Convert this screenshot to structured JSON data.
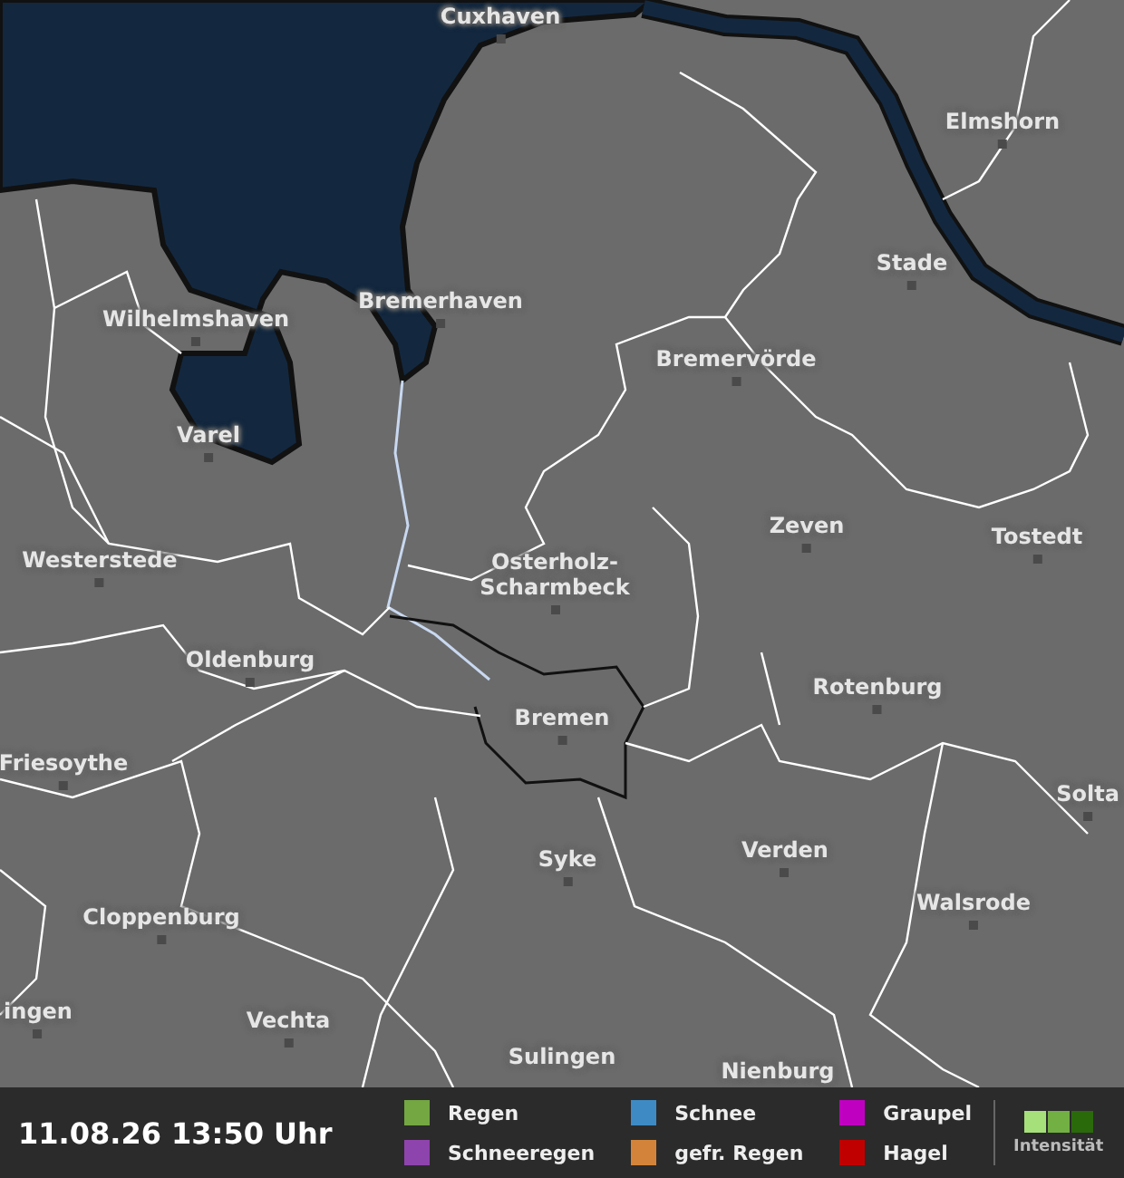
{
  "map": {
    "places": [
      {
        "name": "Cuxhaven"
      },
      {
        "name": "Elmshorn"
      },
      {
        "name": "Bremerhaven"
      },
      {
        "name": "Stade"
      },
      {
        "name": "Wilhelmshaven"
      },
      {
        "name": "Bremervörde"
      },
      {
        "name": "Varel"
      },
      {
        "name": "Zeven"
      },
      {
        "name": "Tostedt"
      },
      {
        "name": "Westerstede"
      },
      {
        "name": "Osterholz-Scharmbeck"
      },
      {
        "name": "Oldenburg"
      },
      {
        "name": "Rotenburg"
      },
      {
        "name": "Bremen"
      },
      {
        "name": "Friesoythe"
      },
      {
        "name": "Solta"
      },
      {
        "name": "Syke"
      },
      {
        "name": "Verden"
      },
      {
        "name": "Walsrode"
      },
      {
        "name": "Cloppenburg"
      },
      {
        "name": "ingen"
      },
      {
        "name": "Vechta"
      },
      {
        "name": "Sulingen"
      },
      {
        "name": "Nienburg"
      }
    ]
  },
  "footer": {
    "timestamp": "11.08.26 13:50 Uhr",
    "legend": [
      {
        "label": "Regen",
        "color": "#74a642"
      },
      {
        "label": "Schneeregen",
        "color": "#8e44ad"
      },
      {
        "label": "Schnee",
        "color": "#3e8ac4"
      },
      {
        "label": "gefr. Regen",
        "color": "#d4843a"
      },
      {
        "label": "Graupel",
        "color": "#c000c0"
      },
      {
        "label": "Hagel",
        "color": "#c00000"
      }
    ],
    "intensity": {
      "label": "Intensität",
      "steps": [
        {
          "color": "#a6e07a"
        },
        {
          "color": "#72b043"
        },
        {
          "color": "#2b6a0a"
        }
      ]
    }
  }
}
